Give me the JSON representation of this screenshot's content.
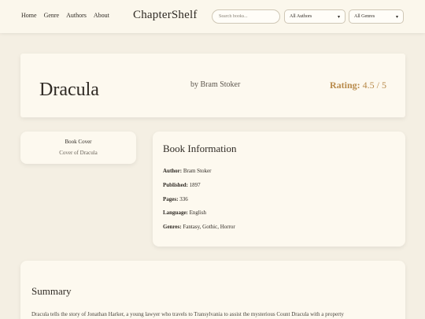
{
  "nav": {
    "home": "Home",
    "genre": "Genre",
    "authors": "Authors",
    "about": "About"
  },
  "brand": "ChapterShelf",
  "search": {
    "placeholder": "Search books..."
  },
  "filters": {
    "authors_selected": "All Authors",
    "genres_selected": "All Genres"
  },
  "book": {
    "title": "Dracula",
    "byline": "by Bram Stoker",
    "rating_label": "Rating:",
    "rating_value": "4.5 / 5"
  },
  "cover": {
    "label": "Book Cover",
    "alt": "Cover of Dracula"
  },
  "info": {
    "heading": "Book Information",
    "rows": [
      {
        "label": "Author:",
        "value": "Bram Stoker"
      },
      {
        "label": "Published:",
        "value": "1897"
      },
      {
        "label": "Pages:",
        "value": "336"
      },
      {
        "label": "Language:",
        "value": "English"
      },
      {
        "label": "Genres:",
        "value": "Fantasy, Gothic, Horror"
      }
    ]
  },
  "summary": {
    "heading": "Summary",
    "text": "Dracula tells the story of Jonathan Harker, a young lawyer who travels to Transylvania to assist the mysterious Count Dracula with a property"
  },
  "colors": {
    "background": "#f4efe3",
    "card": "#fdf9ef",
    "accent_rating": "#b88a4a",
    "text": "#2f2a24"
  }
}
